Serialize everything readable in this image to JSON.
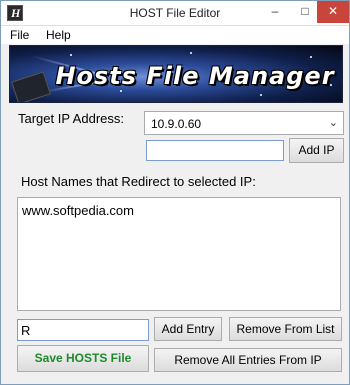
{
  "window": {
    "title": "HOST File Editor",
    "app_icon": "H",
    "controls": {
      "minimize": "–",
      "maximize": "□",
      "close": "✕"
    }
  },
  "menu": {
    "file": "File",
    "help": "Help"
  },
  "banner": {
    "title": "Hosts File Manager"
  },
  "target_ip": {
    "label": "Target IP Address:",
    "selected": "10.9.0.60"
  },
  "add_ip": {
    "input_value": "",
    "button": "Add IP"
  },
  "host_names": {
    "label": "Host Names that Redirect to selected IP:",
    "entries": "www.softpedia.com"
  },
  "entry": {
    "input_value": "R"
  },
  "buttons": {
    "add_entry": "Add Entry",
    "remove_from_list": "Remove From List",
    "save_hosts": "Save HOSTS File",
    "remove_all": "Remove All Entries From IP"
  },
  "colors": {
    "save_button_text": "#1f8a2c",
    "close_button": "#c7453a"
  }
}
